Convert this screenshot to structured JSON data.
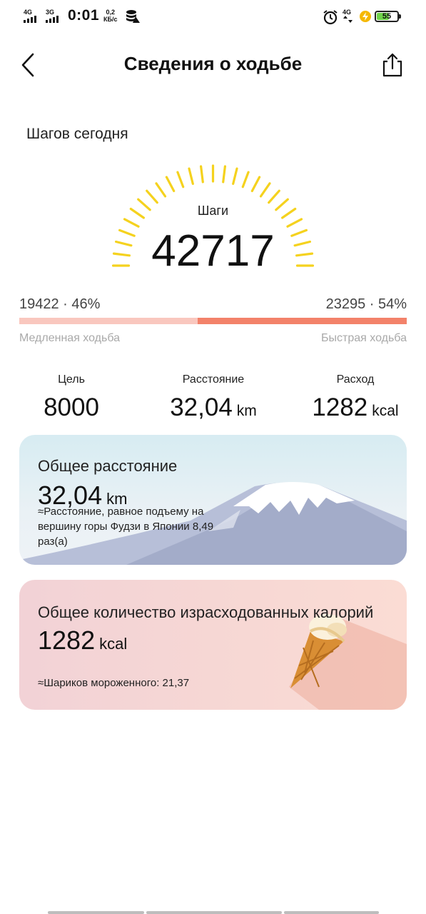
{
  "status_bar": {
    "sig1_label": "4G",
    "sig2_label": "3G",
    "time": "0:01",
    "speed_value": "0,2",
    "speed_unit": "КБ/с",
    "right_net": "4G",
    "battery": "55",
    "icons": [
      "signal-icon",
      "data-icon",
      "alarm-icon",
      "charging-icon",
      "battery-icon"
    ]
  },
  "header": {
    "title": "Сведения о ходьбе",
    "back_icon": "back-icon",
    "share_icon": "share-icon"
  },
  "today": {
    "label": "Шагов сегодня",
    "steps_label": "Шаги",
    "steps_value": "42717",
    "gauge_color": "#f5d21e"
  },
  "split": {
    "slow_text": "19422 · 46%",
    "fast_text": "23295 · 54%",
    "slow_fraction": 0.46,
    "slow_label": "Медленная ходьба",
    "fast_label": "Быстрая ходьба",
    "slow_color": "#f9c7be",
    "fast_color": "#f3826a"
  },
  "stats": {
    "goal_label": "Цель",
    "goal_value": "8000",
    "distance_label": "Расстояние",
    "distance_value": "32,04",
    "distance_unit": "km",
    "burn_label": "Расход",
    "burn_value": "1282",
    "burn_unit": "kcal"
  },
  "distance_card": {
    "heading": "Общее расстояние",
    "value": "32,04",
    "unit": "km",
    "note": "≈Расстояние, равное подъему на вершину горы Фудзи в Японии 8,49 раз(а)"
  },
  "calorie_card": {
    "heading": "Общее количество израсходованных калорий",
    "value": "1282",
    "unit": "kcal",
    "note": "≈Шариков мороженного: 21,37"
  }
}
